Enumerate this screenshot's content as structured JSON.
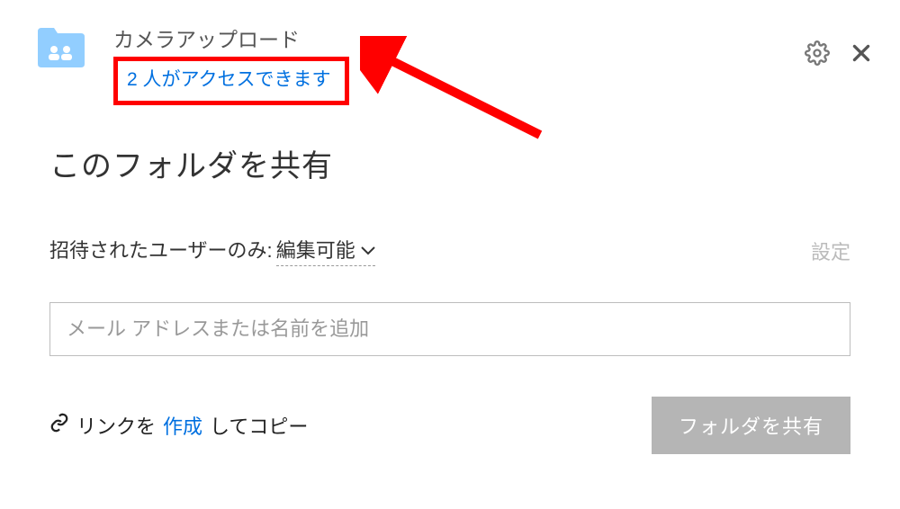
{
  "header": {
    "folder_title": "カメラアップロード",
    "access_text": "2 人がアクセスできます"
  },
  "main": {
    "section_title": "このフォルダを共有",
    "permission_label": "招待されたユーザーのみ:",
    "permission_value": "編集可能",
    "settings_label": "設定",
    "invite_placeholder": "メール アドレスまたは名前を追加",
    "link_prefix": "リンクを",
    "link_action": "作成",
    "link_suffix": "してコピー",
    "share_button": "フォルダを共有"
  },
  "colors": {
    "accent": "#0070e0",
    "annotation": "#ff0000",
    "folder": "#92ceff"
  }
}
